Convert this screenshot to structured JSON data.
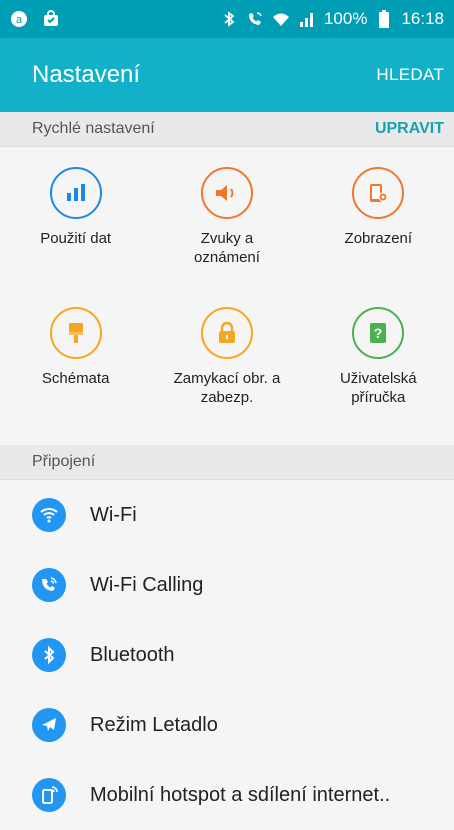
{
  "status_bar": {
    "battery": "100%",
    "time": "16:18",
    "icons": [
      "chat-icon",
      "bag-icon",
      "bluetooth-icon",
      "wifi-calling-icon",
      "wifi-icon",
      "signal-icon",
      "battery-icon"
    ]
  },
  "app_bar": {
    "title": "Nastavení",
    "search_label": "HLEDAT"
  },
  "quick_settings": {
    "header": "Rychlé nastavení",
    "edit_label": "UPRAVIT",
    "items": [
      {
        "label": "Použití dat",
        "icon": "data-usage-icon",
        "color": "#1e88e5"
      },
      {
        "label": "Zvuky a\noznámení",
        "icon": "volume-icon",
        "color": "#f0782a"
      },
      {
        "label": "Zobrazení",
        "icon": "display-icon",
        "color": "#f0782a"
      },
      {
        "label": "Schémata",
        "icon": "paintbrush-icon",
        "color": "#f5a623"
      },
      {
        "label": "Zamykací obr. a\nzabezp.",
        "icon": "lock-icon",
        "color": "#f5a623"
      },
      {
        "label": "Uživatelská\npříručka",
        "icon": "help-book-icon",
        "color": "#4caf50"
      }
    ]
  },
  "connections": {
    "header": "Připojení",
    "items": [
      {
        "label": "Wi-Fi",
        "icon": "wifi-icon"
      },
      {
        "label": "Wi-Fi Calling",
        "icon": "wifi-calling-icon"
      },
      {
        "label": "Bluetooth",
        "icon": "bluetooth-icon"
      },
      {
        "label": "Režim Letadlo",
        "icon": "airplane-icon"
      },
      {
        "label": "Mobilní hotspot a sdílení internet..",
        "icon": "hotspot-icon"
      }
    ],
    "accent": "#2196f3"
  }
}
